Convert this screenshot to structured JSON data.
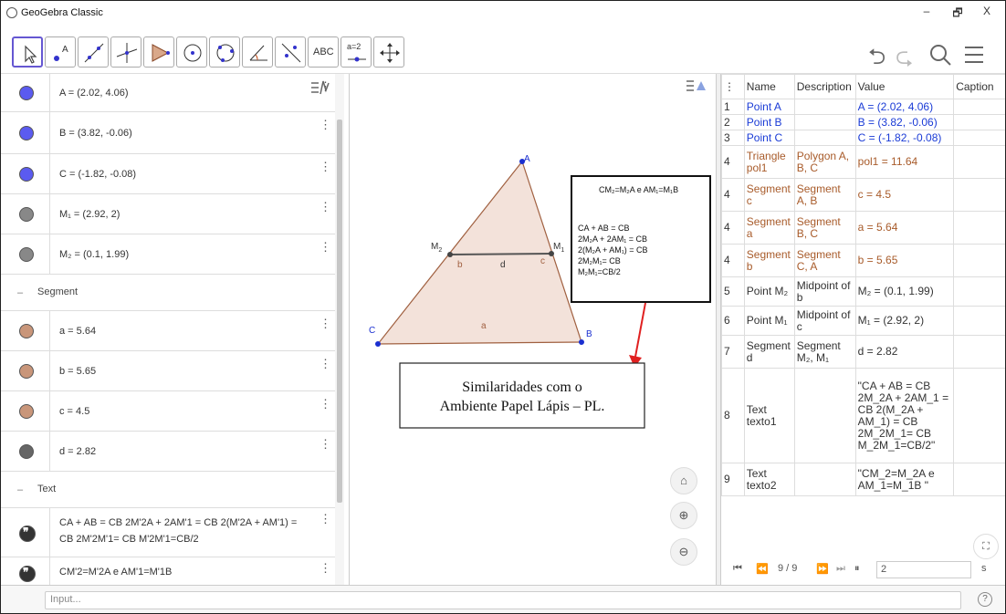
{
  "window": {
    "title": "GeoGebra Classic",
    "minimize": "–",
    "maximize": "🗗",
    "close": "X"
  },
  "toolbar": {
    "text_tool_label": "ABC",
    "slider_tool_label": "a=2"
  },
  "algebra": {
    "points": [
      {
        "text": "A = (2.02, 4.06)",
        "color": "#5b5bf0"
      },
      {
        "text": "B = (3.82, -0.06)",
        "color": "#5b5bf0"
      },
      {
        "text": "C = (-1.82, -0.08)",
        "color": "#5b5bf0"
      },
      {
        "text": "M₁ = (2.92, 2)",
        "color": "#888888"
      },
      {
        "text": "M₂ = (0.1, 1.99)",
        "color": "#888888"
      }
    ],
    "segment_group": "Segment",
    "segments": [
      {
        "text": "a = 5.64",
        "color": "#c9967a"
      },
      {
        "text": "b = 5.65",
        "color": "#c9967a"
      },
      {
        "text": "c = 4.5",
        "color": "#c9967a"
      },
      {
        "text": "d = 2.82",
        "color": "#666666"
      }
    ],
    "text_group": "Text",
    "texts": [
      {
        "line1": "CA + AB = CB 2M'2A + 2AM'1 = CB 2(M'2A + AM'1) =",
        "line2": "CB 2M'2M'1= CB M'2M'1=CB/2"
      },
      {
        "line1": "CM'2=M'2A e AM'1=M'1B",
        "line2": ""
      }
    ]
  },
  "graphics": {
    "labels": {
      "A": "A",
      "B": "B",
      "C": "C",
      "M2": "M",
      "M2sub": "2",
      "M1": "M",
      "M1sub": "1",
      "a": "a",
      "b": "b",
      "c": "c",
      "d": "d"
    },
    "textbox": {
      "head": "CM₂=M₂A e AM₁=M₁B",
      "lines": [
        "CA + AB = CB",
        "2M₂A + 2AM₁ = CB",
        "2(M₂A + AM₁) = CB",
        "2M₂M₁= CB",
        "M₂M₁=CB/2"
      ]
    },
    "annotation": {
      "line1": "Similaridades com o",
      "line2": "Ambiente Papel Lápis – PL."
    }
  },
  "construction": {
    "headers": [
      "",
      "Name",
      "Description",
      "Value",
      "Caption"
    ],
    "rows": [
      {
        "n": "1",
        "name": "Point A",
        "desc": "",
        "value": "A = (2.02, 4.06)",
        "style": "v"
      },
      {
        "n": "2",
        "name": "Point B",
        "desc": "",
        "value": "B = (3.82, -0.06)",
        "style": "v"
      },
      {
        "n": "3",
        "name": "Point C",
        "desc": "",
        "value": "C = (-1.82, -0.08)",
        "style": "v"
      },
      {
        "n": "4",
        "name": "Triangle pol1",
        "desc": "Polygon A, B, C",
        "value": "pol1 = 11.64",
        "style": "b"
      },
      {
        "n": "4",
        "name": "Segment c",
        "desc": "Segment A, B",
        "value": "c = 4.5",
        "style": "b"
      },
      {
        "n": "4",
        "name": "Segment a",
        "desc": "Segment B, C",
        "value": "a = 5.64",
        "style": "b"
      },
      {
        "n": "4",
        "name": "Segment b",
        "desc": "Segment C, A",
        "value": "b = 5.65",
        "style": "b"
      },
      {
        "n": "5",
        "name": "Point M₂",
        "desc": "Midpoint of b",
        "value": "M₂ = (0.1, 1.99)",
        "style": ""
      },
      {
        "n": "6",
        "name": "Point M₁",
        "desc": "Midpoint of c",
        "value": "M₁ = (2.92, 2)",
        "style": ""
      },
      {
        "n": "7",
        "name": "Segment d",
        "desc": "Segment M₂, M₁",
        "value": "d = 2.82",
        "style": ""
      },
      {
        "n": "8",
        "name": "Text texto1",
        "desc": "",
        "value": "\"CA + AB = CB 2M_2A + 2AM_1 = CB 2(M_2A + AM_1) = CB 2M_2M_1= CB M_2M_1=CB/2\"",
        "style": ""
      },
      {
        "n": "9",
        "name": "Text texto2",
        "desc": "",
        "value": "\"CM_2=M_2A e AM_1=M_1B \"",
        "style": ""
      }
    ],
    "nav": {
      "step": "9 / 9",
      "step_input": "2",
      "trailing": "s"
    }
  },
  "inputbar": {
    "placeholder": "Input..."
  },
  "icons": {
    "help": "?"
  }
}
